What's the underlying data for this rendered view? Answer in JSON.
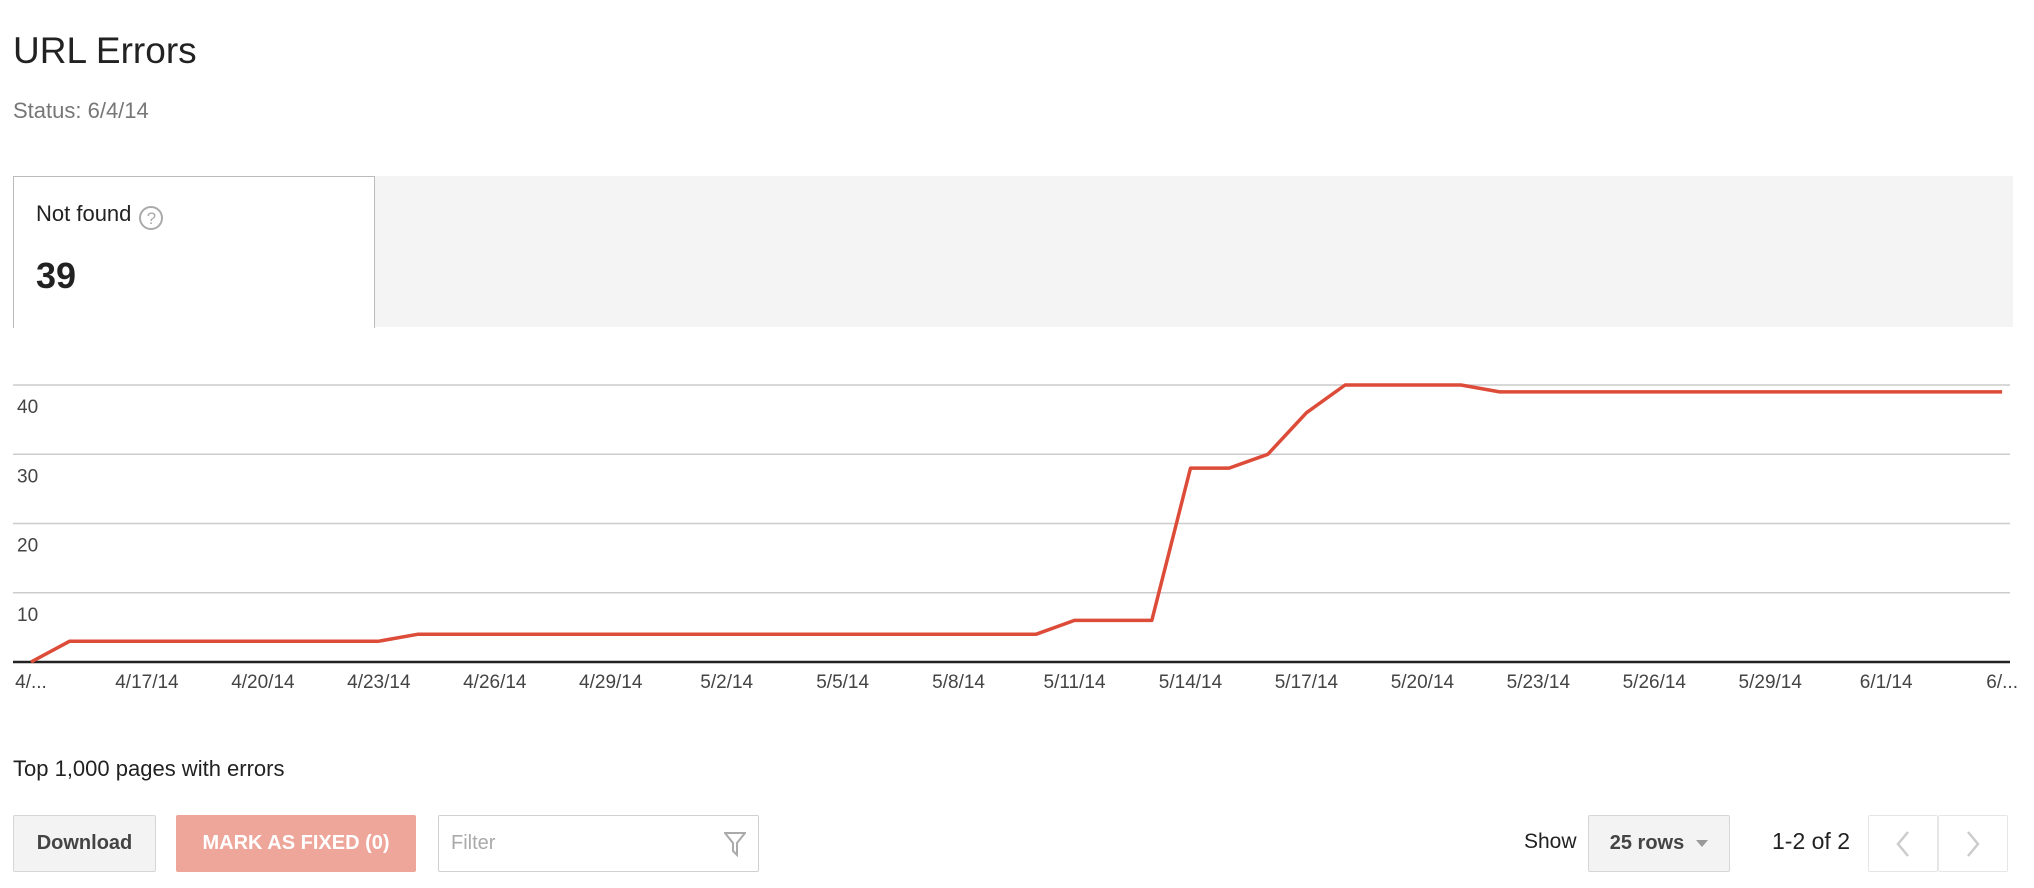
{
  "page": {
    "title": "URL Errors",
    "status": "Status: 6/4/14"
  },
  "tab": {
    "label": "Not found",
    "help_icon": "?",
    "count": "39"
  },
  "chart_data": {
    "type": "line",
    "color": "#dd4b39",
    "x": [
      "4/14/14",
      "4/15/14",
      "4/16/14",
      "4/17/14",
      "4/18/14",
      "4/19/14",
      "4/20/14",
      "4/21/14",
      "4/22/14",
      "4/23/14",
      "4/24/14",
      "4/25/14",
      "4/26/14",
      "4/27/14",
      "4/28/14",
      "4/29/14",
      "4/30/14",
      "5/1/14",
      "5/2/14",
      "5/3/14",
      "5/4/14",
      "5/5/14",
      "5/6/14",
      "5/7/14",
      "5/8/14",
      "5/9/14",
      "5/10/14",
      "5/11/14",
      "5/12/14",
      "5/13/14",
      "5/14/14",
      "5/15/14",
      "5/16/14",
      "5/17/14",
      "5/18/14",
      "5/19/14",
      "5/20/14",
      "5/21/14",
      "5/22/14",
      "5/23/14",
      "5/24/14",
      "5/25/14",
      "5/26/14",
      "5/27/14",
      "5/28/14",
      "5/29/14",
      "5/30/14",
      "5/31/14",
      "6/1/14",
      "6/2/14",
      "6/3/14",
      "6/4/14"
    ],
    "values": [
      0,
      3,
      3,
      3,
      3,
      3,
      3,
      3,
      3,
      3,
      4,
      4,
      4,
      4,
      4,
      4,
      4,
      4,
      4,
      4,
      4,
      4,
      4,
      4,
      4,
      4,
      4,
      6,
      6,
      6,
      28,
      28,
      30,
      36,
      40,
      40,
      40,
      40,
      39,
      39,
      39,
      39,
      39,
      39,
      39,
      39,
      39,
      39,
      39,
      39,
      39,
      39
    ],
    "ylim": [
      0,
      40
    ],
    "yticks": [
      "10",
      "20",
      "30",
      "40"
    ],
    "xtick_labels": [
      "4/...",
      "4/17/14",
      "4/20/14",
      "4/23/14",
      "4/26/14",
      "4/29/14",
      "5/2/14",
      "5/5/14",
      "5/8/14",
      "5/11/14",
      "5/14/14",
      "5/17/14",
      "5/20/14",
      "5/23/14",
      "5/26/14",
      "5/29/14",
      "6/1/14",
      "6/..."
    ],
    "grid": true
  },
  "table": {
    "heading": "Top 1,000 pages with errors",
    "download_label": "Download",
    "mark_fixed_label": "MARK AS FIXED (0)",
    "filter_placeholder": "Filter",
    "show_label": "Show",
    "rows_option": "25 rows",
    "pager_text": "1-2 of 2"
  }
}
